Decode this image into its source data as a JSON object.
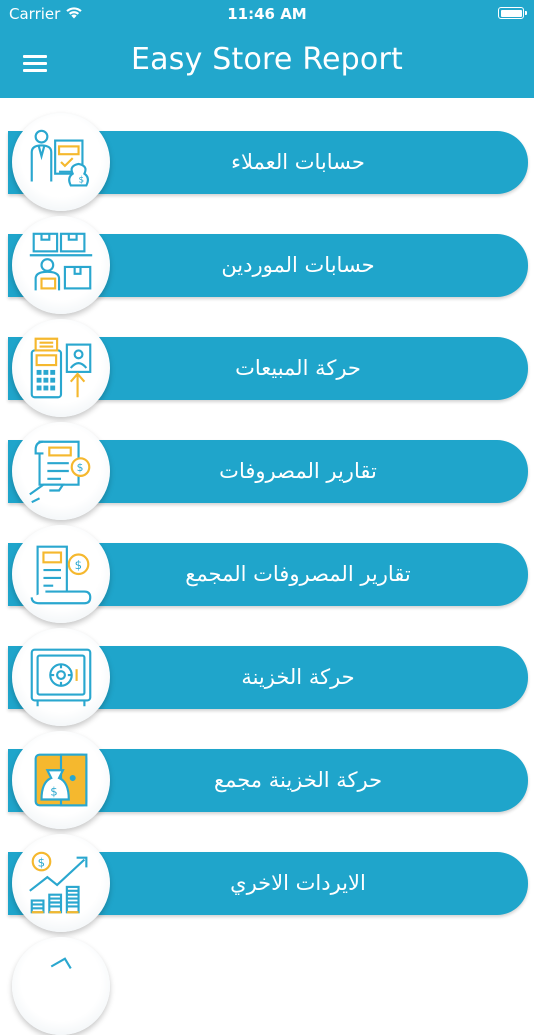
{
  "status_bar": {
    "carrier": "Carrier",
    "time": "11:46 AM"
  },
  "header": {
    "title": "Easy Store Report"
  },
  "menu_items": [
    {
      "label": "حسابات العملاء",
      "icon": "customer-accounts-icon"
    },
    {
      "label": "حسابات الموردين",
      "icon": "supplier-boxes-icon"
    },
    {
      "label": "حركة المبيعات",
      "icon": "pos-terminal-icon"
    },
    {
      "label": "تقارير المصروفات",
      "icon": "expense-receipt-icon"
    },
    {
      "label": "تقارير المصروفات المجمع",
      "icon": "aggregate-expense-receipt-icon"
    },
    {
      "label": "حركة الخزينة",
      "icon": "safe-icon"
    },
    {
      "label": "حركة الخزينة مجمع",
      "icon": "wallet-money-bag-icon"
    },
    {
      "label": "الايردات الاخري",
      "icon": "revenue-growth-chart-icon"
    }
  ],
  "colors": {
    "primary": "#22a7cc",
    "icon_blue": "#2aa7cf",
    "icon_yellow": "#f5b82e"
  }
}
